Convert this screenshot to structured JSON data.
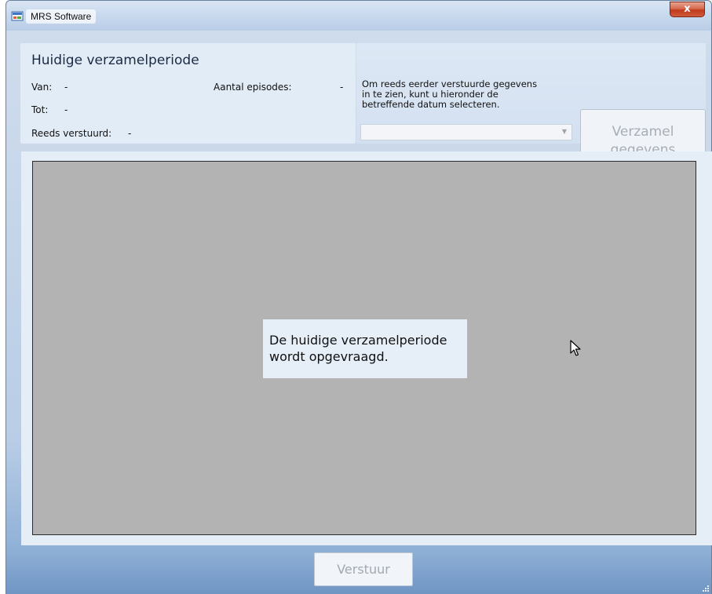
{
  "window": {
    "title": "MRS Software",
    "close_label": "x"
  },
  "period": {
    "heading": "Huidige verzamelperiode",
    "van_label": "Van:",
    "van_value": "-",
    "tot_label": "Tot:",
    "tot_value": "-",
    "sent_label": "Reeds verstuurd:",
    "sent_value": "-",
    "episodes_label": "Aantal episodes:",
    "episodes_value": "-"
  },
  "history": {
    "hint_line1": "Om reeds eerder verstuurde gegevens",
    "hint_line2": "in te zien, kunt u hieronder de",
    "hint_line3": "betreffende datum selecteren.",
    "date_select_value": ""
  },
  "buttons": {
    "collect_line1": "Verzamel",
    "collect_line2": "gegevens",
    "send": "Verstuur"
  },
  "status": {
    "line1": "De huidige verzamelperiode",
    "line2": "wordt opgevraagd."
  },
  "colors": {
    "panel_gray": "#b3b3b3",
    "disabled_text": "#a7aeb7",
    "close_red": "#c2391c"
  }
}
